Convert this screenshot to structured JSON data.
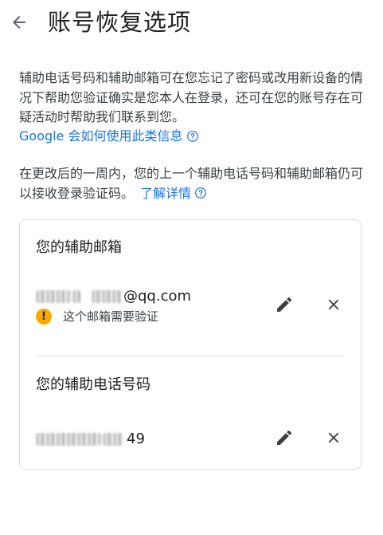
{
  "header": {
    "title": "账号恢复选项"
  },
  "intro": {
    "text": "辅助电话号码和辅助邮箱可在您忘记了密码或改用新设备的情况下帮助您验证确实是您本人在登录，还可在您的账号存在可疑活动时帮助我们联系到您。",
    "link_label": "Google 会如何使用此类信息"
  },
  "notice": {
    "text": "在更改后的一周内，您的上一个辅助电话号码和辅助邮箱仍可以接收登录验证码。",
    "link_label": "了解详情"
  },
  "recovery_email": {
    "title": "您的辅助邮箱",
    "value_visible": "@qq.com",
    "warning": "这个邮箱需要验证"
  },
  "recovery_phone": {
    "title": "您的辅助电话号码",
    "value_visible": "49"
  },
  "colors": {
    "link": "#1a73e8",
    "warning": "#f9ab00",
    "border": "#dadce0"
  },
  "icons": [
    "arrow-back-icon",
    "help-icon",
    "warning-icon",
    "edit-icon",
    "close-icon"
  ]
}
